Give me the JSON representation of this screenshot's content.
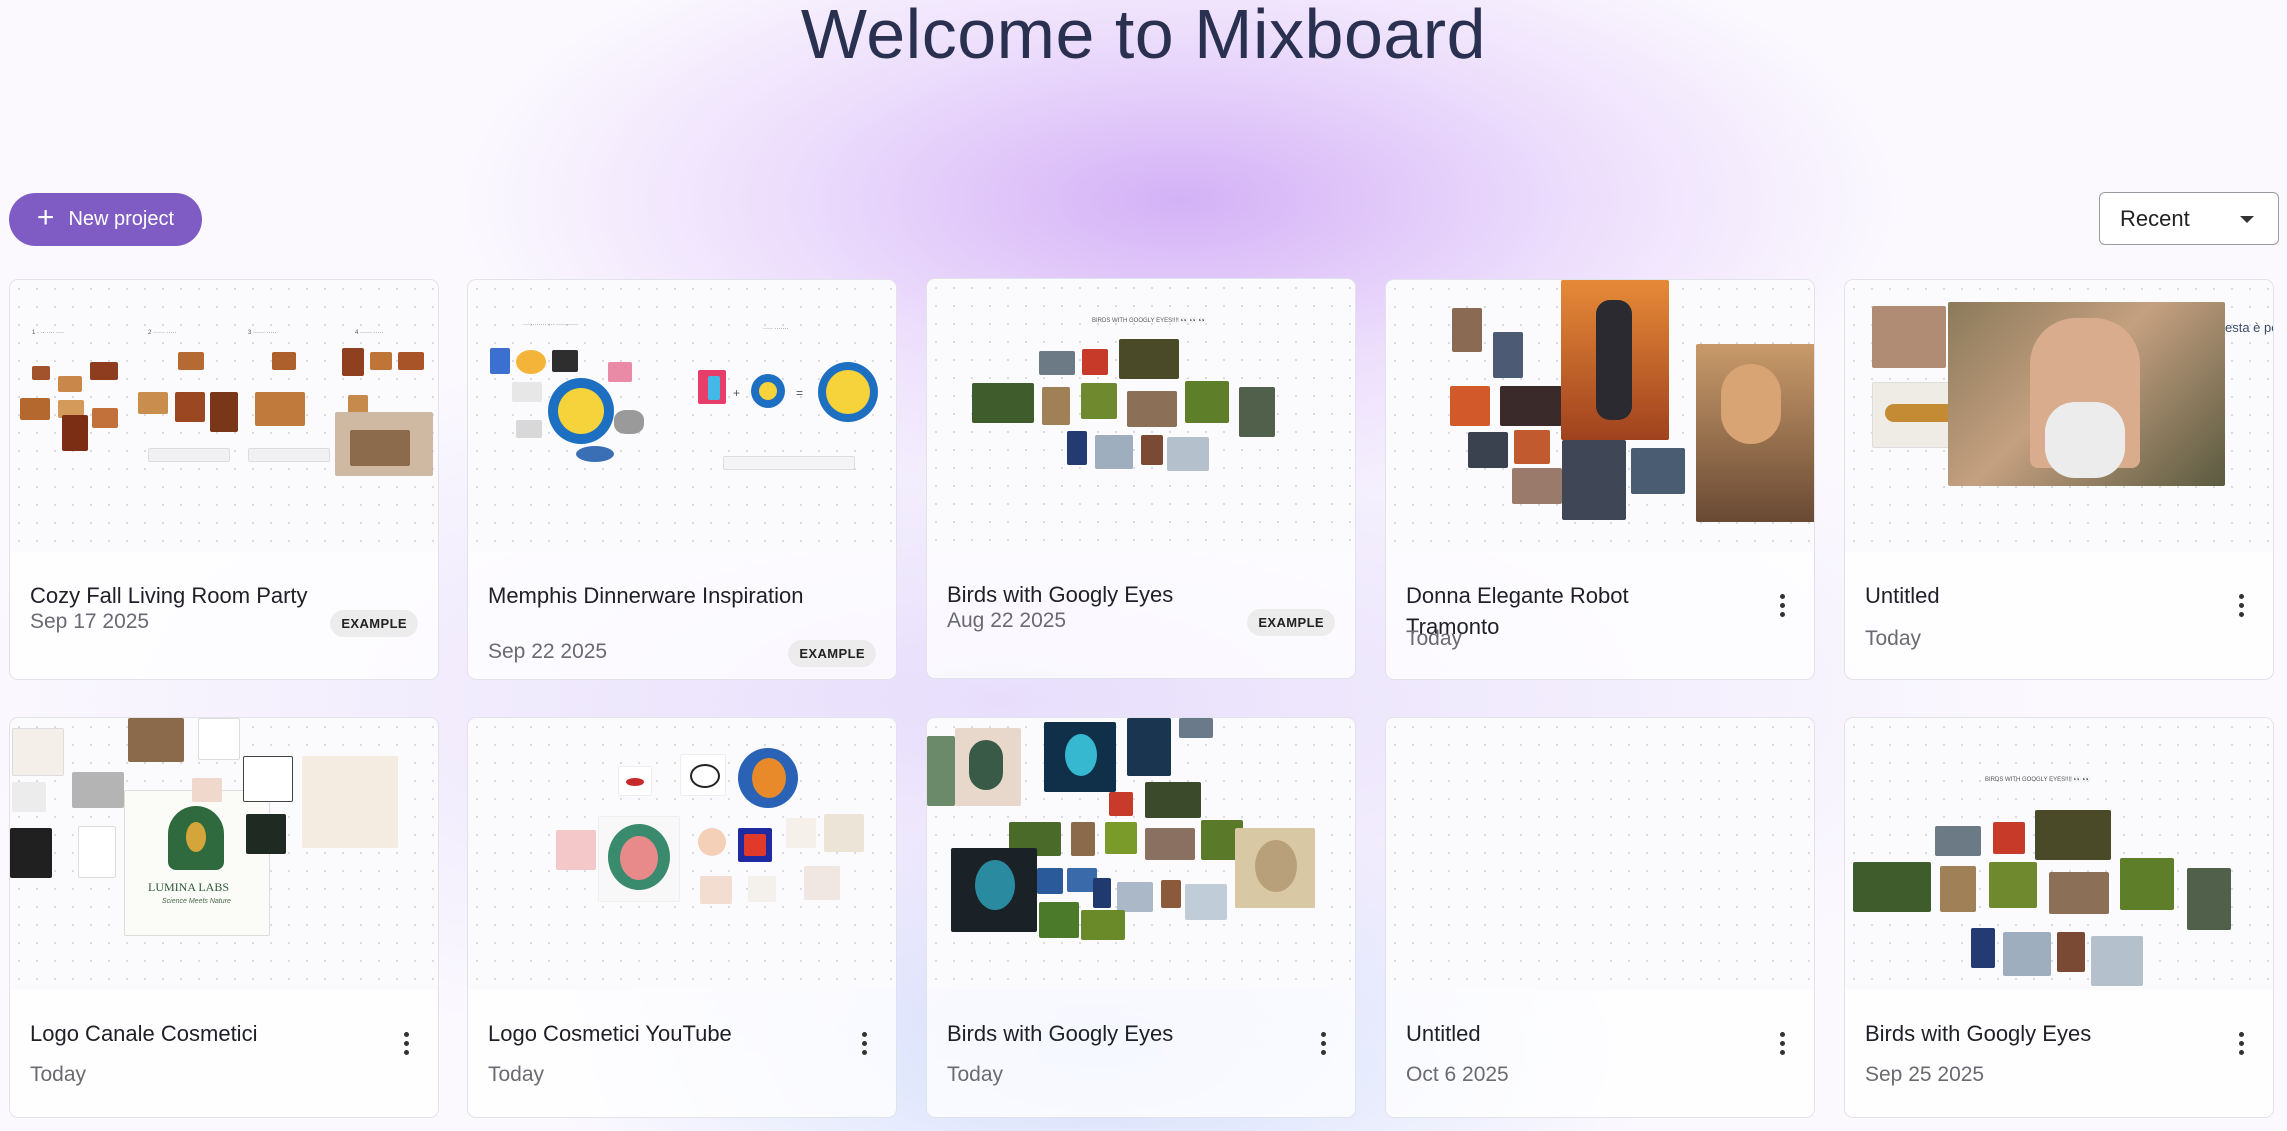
{
  "header": {
    "title": "Welcome to Mixboard"
  },
  "toolbar": {
    "new_project_label": "New project",
    "sort_value": "Recent"
  },
  "projects": [
    {
      "name": "Cozy Fall Living Room Party",
      "date": "Sep 17 2025",
      "badge": "EXAMPLE"
    },
    {
      "name": "Memphis Dinnerware Inspiration",
      "date": "Sep 22 2025",
      "badge": "EXAMPLE"
    },
    {
      "name": "Birds with Googly Eyes",
      "date": "Aug 22 2025",
      "badge": "EXAMPLE",
      "thumb_caption": "BIRDS WITH GOOGLY EYES!!!! 👀 👀 👀"
    },
    {
      "name": "Donna Elegante Robot Tramonto",
      "date": "Today"
    },
    {
      "name": "Untitled",
      "date": "Today",
      "thumb_caption": "esta è pe"
    },
    {
      "name": "Logo Canale Cosmetici",
      "date": "Today",
      "thumb_caption": "LUMINA LABS",
      "thumb_subcaption": "Science Meets Nature"
    },
    {
      "name": "Logo Cosmetici YouTube",
      "date": "Today"
    },
    {
      "name": "Birds with Googly Eyes",
      "date": "Today"
    },
    {
      "name": "Untitled",
      "date": "Oct 6 2025"
    },
    {
      "name": "Birds with Googly Eyes",
      "date": "Sep 25 2025",
      "thumb_caption": "BIRDS WITH GOOGLY EYES!!!! 👀 👀"
    }
  ],
  "icons": {
    "add": "plus-icon",
    "menu": "more-vert-icon",
    "dropdown": "caret-down-icon"
  }
}
